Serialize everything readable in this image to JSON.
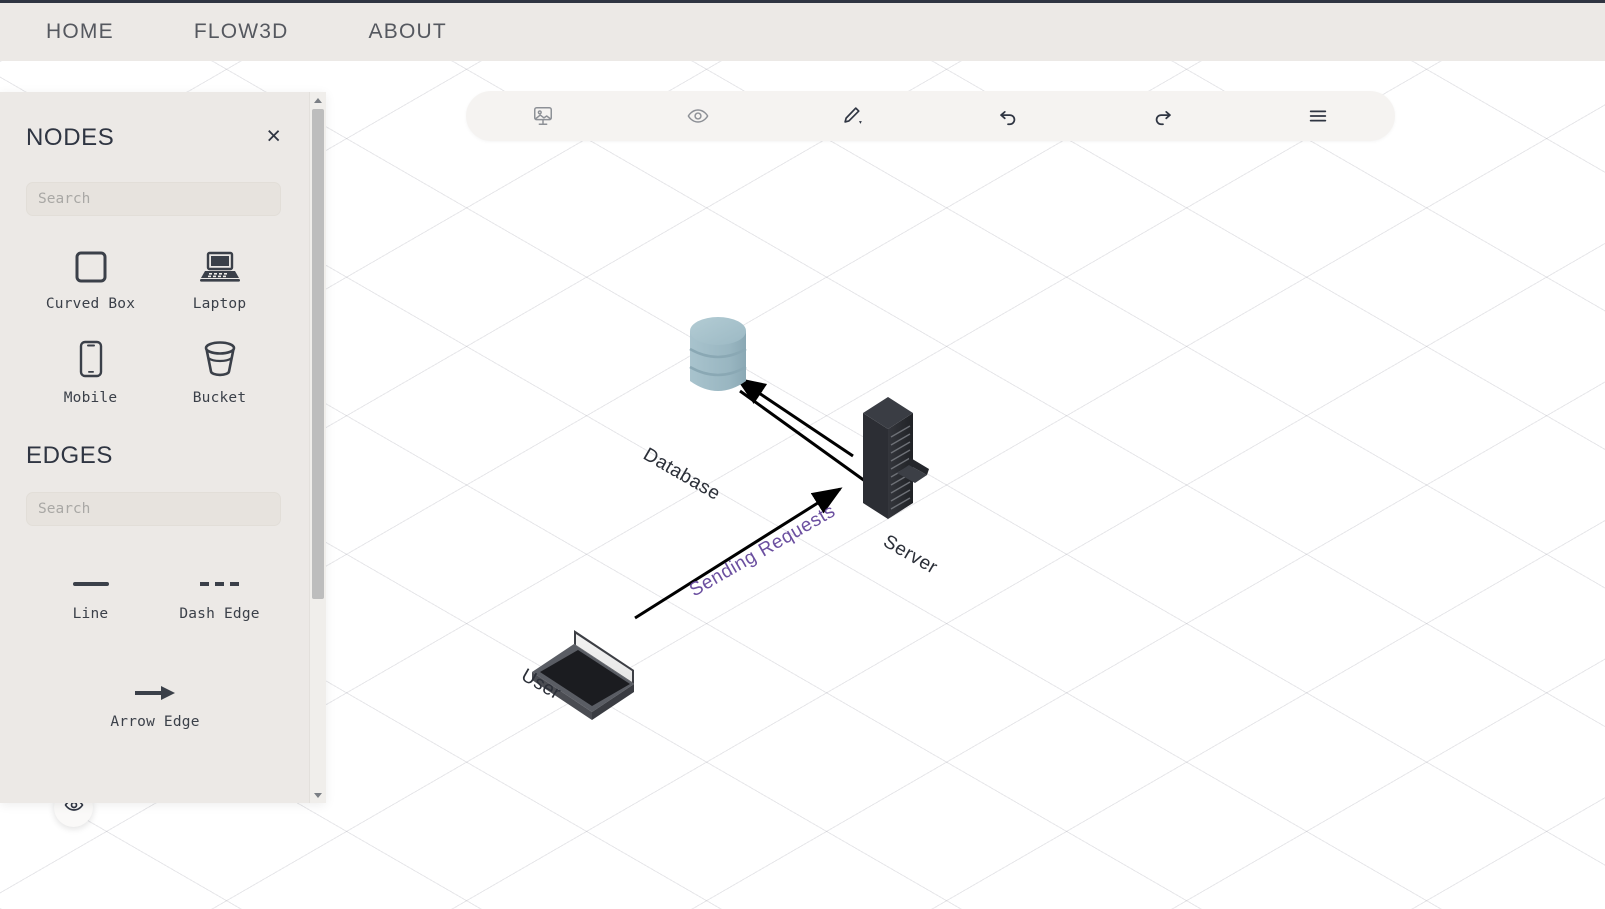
{
  "nav": {
    "items": [
      {
        "label": "HOME",
        "name": "nav-link-home"
      },
      {
        "label": "FLOW3D",
        "name": "nav-link-flow3d"
      },
      {
        "label": "ABOUT",
        "name": "nav-link-about"
      }
    ]
  },
  "toolbar": {
    "buttons": [
      {
        "icon": "export-image-icon",
        "name": "export-image-button"
      },
      {
        "icon": "eye-icon",
        "name": "preview-button"
      },
      {
        "icon": "pen-dropdown-icon",
        "name": "pen-tool-button"
      },
      {
        "icon": "undo-icon",
        "name": "undo-button"
      },
      {
        "icon": "redo-icon",
        "name": "redo-button"
      },
      {
        "icon": "hamburger-icon",
        "name": "menu-button"
      }
    ]
  },
  "sidebar": {
    "nodes_title": "NODES",
    "edges_title": "EDGES",
    "close_label": "×",
    "nodes_search_placeholder": "Search",
    "nodes_search_value": "",
    "edges_search_placeholder": "Search",
    "edges_search_value": "",
    "nodes": [
      {
        "label": "Curved Box",
        "icon": "curved-box-icon"
      },
      {
        "label": "Laptop",
        "icon": "laptop-icon"
      },
      {
        "label": "Mobile",
        "icon": "mobile-icon"
      },
      {
        "label": "Bucket",
        "icon": "bucket-icon"
      }
    ],
    "edges": [
      {
        "label": "Line",
        "icon": "solid-line-icon"
      },
      {
        "label": "Dash Edge",
        "icon": "dashed-line-icon"
      },
      {
        "label": "Arrow Edge",
        "icon": "arrow-line-icon"
      }
    ]
  },
  "canvas": {
    "fab_icon": "eye-icon",
    "nodes": [
      {
        "id": "database",
        "label": "Database",
        "type": "database-cylinder",
        "color": "#9cb9c4"
      },
      {
        "id": "server",
        "label": "Server",
        "type": "server-rack",
        "color": "#2b2d33"
      },
      {
        "id": "user",
        "label": "User",
        "type": "laptop",
        "color": "#4a4c52"
      }
    ],
    "edges": [
      {
        "from": "server",
        "to": "database",
        "label": "",
        "style": "arrow"
      },
      {
        "from": "database",
        "to": "server",
        "label": "",
        "style": "arrow"
      },
      {
        "from": "user",
        "to": "server",
        "label": "Sending Requests",
        "style": "arrow",
        "label_color": "#6b4fa0"
      }
    ]
  },
  "colors": {
    "nav_bg": "#ece9e6",
    "sidebar_bg": "#ece9e6",
    "toolbar_bg": "#f5f3f1",
    "accent_dark": "#2f3542",
    "edge_label": "#6b4fa0",
    "database": "#9cb9c4"
  }
}
